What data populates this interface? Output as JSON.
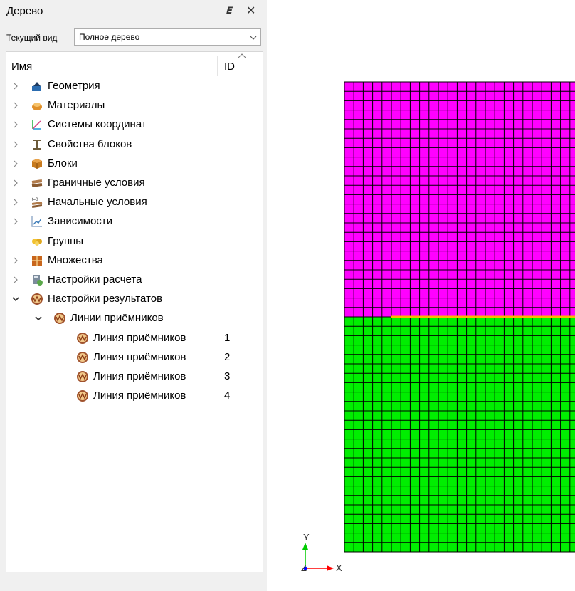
{
  "panel": {
    "title": "Дерево",
    "float_glyph": "𝗘",
    "close_glyph": "✕",
    "view_label": "Текущий вид",
    "view_value": "Полное дерево"
  },
  "tree": {
    "col_name": "Имя",
    "col_id": "ID",
    "items": [
      {
        "label": "Геометрия",
        "icon": "geometry-icon",
        "level": 0,
        "expander": "collapsed",
        "id": ""
      },
      {
        "label": "Материалы",
        "icon": "materials-icon",
        "level": 0,
        "expander": "collapsed",
        "id": ""
      },
      {
        "label": "Системы координат",
        "icon": "coordinate-systems-icon",
        "level": 0,
        "expander": "collapsed",
        "id": ""
      },
      {
        "label": "Свойства блоков",
        "icon": "block-properties-icon",
        "level": 0,
        "expander": "collapsed",
        "id": ""
      },
      {
        "label": "Блоки",
        "icon": "blocks-icon",
        "level": 0,
        "expander": "collapsed",
        "id": ""
      },
      {
        "label": "Граничные условия",
        "icon": "boundary-conditions-icon",
        "level": 0,
        "expander": "collapsed",
        "id": ""
      },
      {
        "label": "Начальные условия",
        "icon": "initial-conditions-icon",
        "level": 0,
        "expander": "collapsed",
        "id": ""
      },
      {
        "label": "Зависимости",
        "icon": "dependencies-icon",
        "level": 0,
        "expander": "collapsed",
        "id": ""
      },
      {
        "label": "Группы",
        "icon": "groups-icon",
        "level": 0,
        "expander": "none",
        "id": ""
      },
      {
        "label": "Множества",
        "icon": "sets-icon",
        "level": 0,
        "expander": "collapsed",
        "id": ""
      },
      {
        "label": "Настройки расчета",
        "icon": "calculation-settings-icon",
        "level": 0,
        "expander": "collapsed",
        "id": ""
      },
      {
        "label": "Настройки результатов",
        "icon": "receiver-icon",
        "level": 0,
        "expander": "expanded",
        "id": ""
      },
      {
        "label": "Линии приёмников",
        "icon": "receiver-icon",
        "level": 1,
        "expander": "expanded",
        "id": ""
      },
      {
        "label": "Линия приёмников",
        "icon": "receiver-icon",
        "level": 2,
        "expander": "none",
        "id": "1"
      },
      {
        "label": "Линия приёмников",
        "icon": "receiver-icon",
        "level": 2,
        "expander": "none",
        "id": "2"
      },
      {
        "label": "Линия приёмников",
        "icon": "receiver-icon",
        "level": 2,
        "expander": "none",
        "id": "3"
      },
      {
        "label": "Линия приёмников",
        "icon": "receiver-icon",
        "level": 2,
        "expander": "none",
        "id": "4"
      }
    ]
  },
  "viewport": {
    "mesh": {
      "columns": 25,
      "top_rows": 25,
      "bottom_rows": 25,
      "top_color": "#ff00ff",
      "bottom_color": "#00ee00",
      "interface_color": "#ffb400",
      "grid_color": "#000000"
    },
    "axes": {
      "y_label": "Y",
      "z_label": "Z",
      "x_label": "X",
      "x_color": "#ff0000",
      "y_color": "#00cc00",
      "z_color": "#0000ff"
    }
  }
}
